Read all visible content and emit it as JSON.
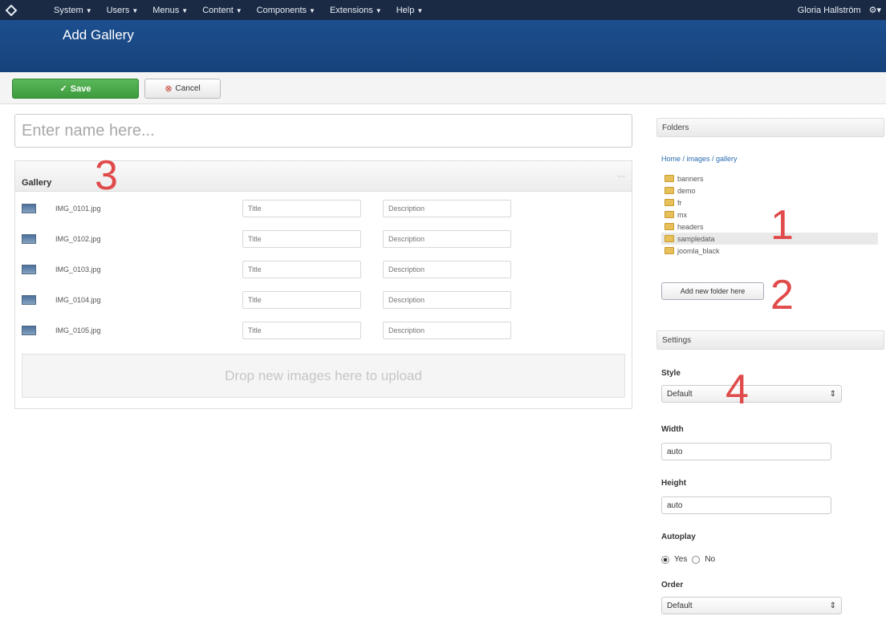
{
  "topnav": {
    "menu": [
      "System",
      "Users",
      "Menus",
      "Content",
      "Components",
      "Extensions",
      "Help"
    ],
    "user": "Gloria Hallström",
    "gear": "gear-icon"
  },
  "title": "Add Gallery",
  "toolbar": {
    "save_label": "Save",
    "cancel_label": "Cancel"
  },
  "name_placeholder": "Enter name here...",
  "gallery": {
    "heading": "Gallery",
    "toggle": "⋯",
    "title_placeholder": "Title",
    "desc_placeholder": "Description",
    "rows": [
      {
        "filename": "IMG_0101.jpg"
      },
      {
        "filename": "IMG_0102.jpg"
      },
      {
        "filename": "IMG_0103.jpg"
      },
      {
        "filename": "IMG_0104.jpg"
      },
      {
        "filename": "IMG_0105.jpg"
      }
    ],
    "dropzone": "Drop new images here to upload"
  },
  "folders": {
    "heading": "Folders",
    "breadcrumb": "Home / images / gallery",
    "items": [
      "banners",
      "demo",
      "fr",
      "mx",
      "headers",
      "sampledata",
      "joomla_black"
    ],
    "selected_index": 5,
    "add_button": "Add new folder here"
  },
  "settings": {
    "heading": "Settings",
    "style_label": "Style",
    "style_value": "Default",
    "width_label": "Width",
    "width_value": "auto",
    "height_label": "Height",
    "height_value": "auto",
    "autoplay_label": "Autoplay",
    "autoplay_yes": "Yes",
    "autoplay_no": "No",
    "order_label": "Order",
    "order_value": "Default"
  },
  "annotations": [
    "1",
    "2",
    "3",
    "4"
  ],
  "colors": {
    "accent": "#1c4f8f",
    "save": "#3d9a3d",
    "annotation": "#e04a4a"
  }
}
